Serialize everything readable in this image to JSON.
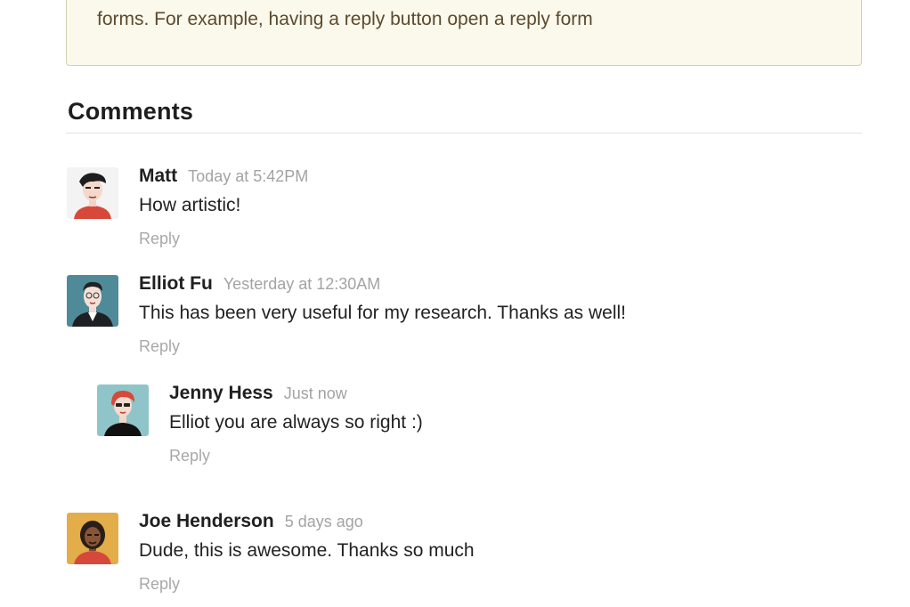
{
  "notice": {
    "text": "forms. For example, having a reply button open a reply form"
  },
  "section": {
    "title": "Comments"
  },
  "comments": [
    {
      "author": "Matt",
      "time": "Today at 5:42PM",
      "text": "How artistic!",
      "reply_label": "Reply",
      "avatar_icon": "avatar-matt-icon"
    },
    {
      "author": "Elliot Fu",
      "time": "Yesterday at 12:30AM",
      "text": "This has been very useful for my research. Thanks as well!",
      "reply_label": "Reply",
      "avatar_icon": "avatar-elliot-icon"
    },
    {
      "author": "Jenny Hess",
      "time": "Just now",
      "text": "Elliot you are always so right :)",
      "reply_label": "Reply",
      "avatar_icon": "avatar-jenny-icon"
    },
    {
      "author": "Joe Henderson",
      "time": "5 days ago",
      "text": "Dude, this is awesome. Thanks so much",
      "reply_label": "Reply",
      "avatar_icon": "avatar-joe-icon"
    }
  ],
  "colors": {
    "notice_background": "#fbf8ec",
    "notice_border": "#d8cfb2",
    "notice_text": "#5c4a2e",
    "meta_text": "#a3a3a3"
  }
}
